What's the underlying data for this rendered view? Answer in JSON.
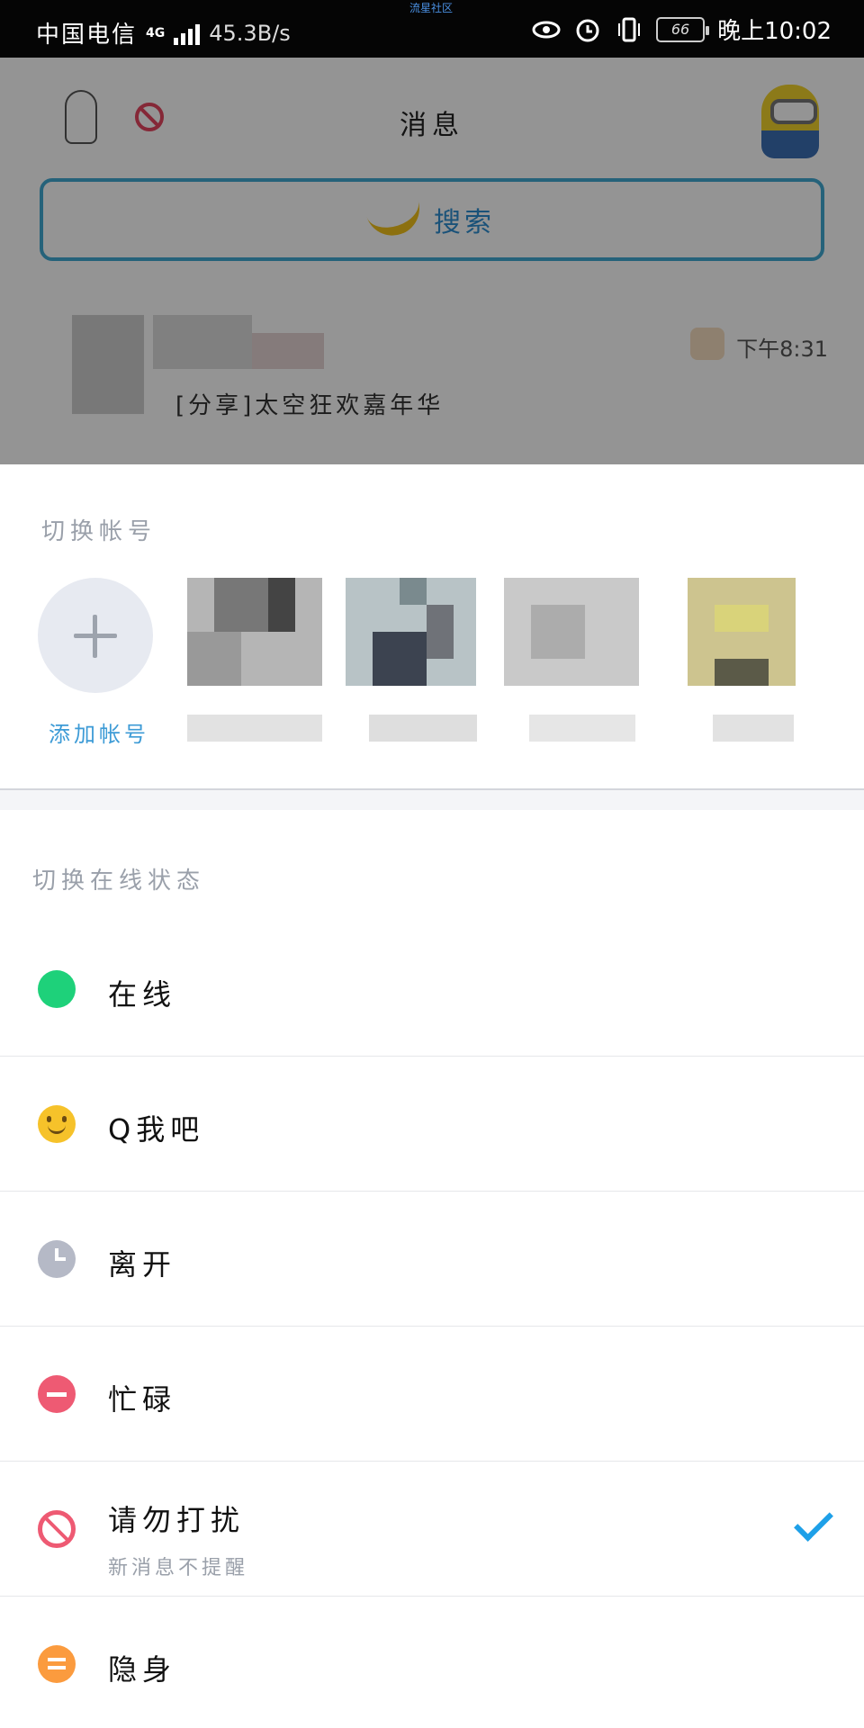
{
  "status_bar": {
    "carrier": "中国电信",
    "network": "4G",
    "speed": "45.3B/s",
    "center_label": "流星社区",
    "battery": "66",
    "time": "晚上10:02"
  },
  "background_app": {
    "title": "消息",
    "search_label": "搜索",
    "chat_preview": "[分享]太空狂欢嘉年华",
    "chat_time": "下午8:31"
  },
  "switch_account": {
    "title": "切换帐号",
    "add_label": "添加帐号"
  },
  "switch_status": {
    "title": "切换在线状态",
    "items": [
      {
        "label": "在线",
        "icon": "online-icon",
        "color": "#1ed17a"
      },
      {
        "label": "Q我吧",
        "icon": "smile-icon",
        "color": "#f6c22a"
      },
      {
        "label": "离开",
        "icon": "clock-icon",
        "color": "#b5b9c6"
      },
      {
        "label": "忙碌",
        "icon": "minus-icon",
        "color": "#ee5a73"
      },
      {
        "label": "请勿打扰",
        "sub": "新消息不提醒",
        "icon": "no-entry-icon",
        "color": "#ee5a73",
        "selected": true
      },
      {
        "label": "隐身",
        "icon": "equals-icon",
        "color": "#fb9b3e"
      }
    ]
  }
}
